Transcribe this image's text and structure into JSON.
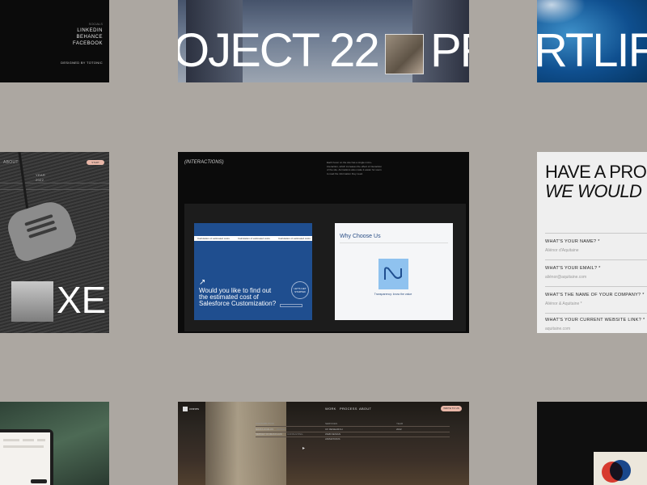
{
  "card1": {
    "label": "SOCIALS",
    "links": [
      "LINKEDIN",
      "BEHANCE",
      "FACEBOOK"
    ],
    "designed_by": "DESIGNED BY TOTONIC"
  },
  "card2": {
    "headline": "OJECT 22",
    "headline_tail": "PR"
  },
  "card3": {
    "headline": "RTLIF"
  },
  "card4": {
    "badge": "START PROJECT",
    "headline": "XE",
    "small_top": "ABOUT",
    "small_a": "YEAR",
    "small_b": "2022"
  },
  "card5": {
    "heading": "(INTERACTIONS)",
    "description": "Each hover on the site has a single micro-interaction, which increases the effect of interaction of the site. Animations also make it easier for users to read the information they need.",
    "tabs": [
      "Calculation of estimated costs",
      "Calculation of estimated costs",
      "Calculation of estimated costs"
    ],
    "arrow": "↗",
    "question": "Would you like to find out the estimated cost of Salesforce Customization?",
    "circle_text": "LET'S GET STARTED",
    "why_title": "Why Choose Us",
    "why_caption": "Transparency: know the value"
  },
  "card6": {
    "headline_1": "HAVE A PRO",
    "headline_2": "WE WOULD",
    "fields": [
      {
        "q": "WHAT'S YOUR NAME? *",
        "a": "Aliénor d'Aquitaine"
      },
      {
        "q": "WHAT'S YOUR EMAIL? *",
        "a": "aliénor@aquitaine.com"
      },
      {
        "q": "WHAT'S THE NAME OF YOUR COMPANY? *",
        "a": "Aliénor & Aquitaine *"
      },
      {
        "q": "WHAT'S YOUR CURRENT WEBSITE LINK? *",
        "a": "aquitaine.com"
      }
    ]
  },
  "card8": {
    "logo": "cranes",
    "nav": [
      "WORK",
      "PROCESS",
      "ABOUT"
    ],
    "cta": "WRITE TO US",
    "col_a_head": "CONTRIBUTION",
    "col_a": [
      "NIKITA KOZLOV",
      "SERGEY ROMANCHUK"
    ],
    "col_a_role": [
      "DESIGN",
      "CONSULTING"
    ],
    "col_b_head": "SERVICES",
    "col_b": [
      "UX RESEARCH",
      "WEB DESIGN",
      "ANIMATIONS"
    ],
    "col_c_head": "YEAR",
    "col_c": [
      "2022"
    ]
  },
  "colors": {
    "background": "#aca7a1",
    "accent_blue": "#1f4e8f",
    "accent_pink": "#e9b7a8"
  }
}
